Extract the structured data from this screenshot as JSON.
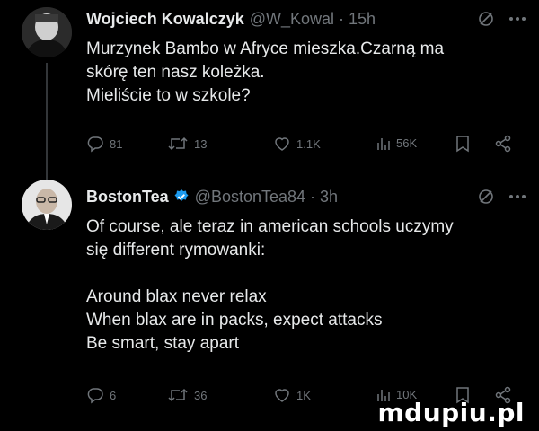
{
  "tweet1": {
    "display_name": "Wojciech Kowalczyk",
    "handle_time": "@W_Kowal · 15h",
    "lines": [
      "Murzynek Bambo w Afryce mieszka.Czarną ma",
      "skórę ten nasz koleżka.",
      "Mieliście to w szkole?"
    ],
    "replies": "81",
    "retweets": "13",
    "likes": "1.1K",
    "views": "56K"
  },
  "tweet2": {
    "display_name": "BostonTea",
    "handle_time": "@BostonTea84 · 3h",
    "lines": [
      "Of course, ale teraz in american schools uczymy",
      "się different rymowanki:",
      "",
      "Around blax never relax",
      "When blax are in packs, expect attacks",
      "Be smart, stay apart"
    ],
    "replies": "6",
    "retweets": "36",
    "likes": "1K",
    "views": "10K"
  },
  "watermark": "mdupiu.pl",
  "colors": {
    "background": "#000000",
    "text": "#e7e9ea",
    "muted": "#71767b",
    "verified": "#1d9bf0"
  },
  "icons": [
    "grok-icon",
    "more-icon",
    "reply-icon",
    "retweet-icon",
    "like-icon",
    "views-icon",
    "bookmark-icon",
    "share-icon",
    "verified-badge-icon"
  ]
}
